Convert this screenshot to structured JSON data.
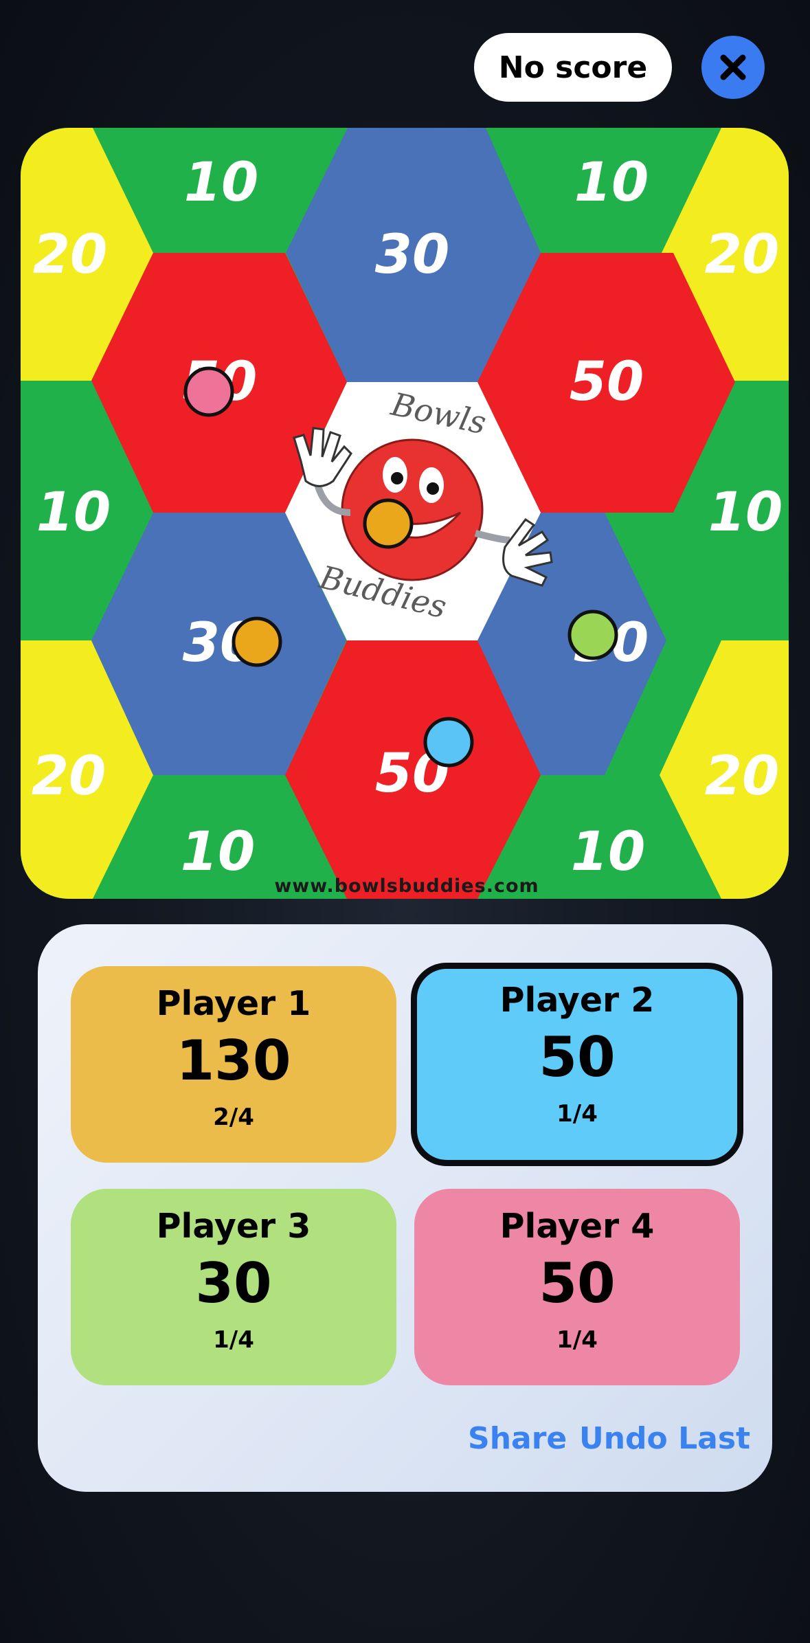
{
  "header": {
    "no_score_label": "No score",
    "close_icon": "close-icon"
  },
  "board": {
    "url": "www.bowlsbuddies.com",
    "logo_word1": "Bowls",
    "logo_word2": "Buddies",
    "zones": {
      "top_left_10": "10",
      "top_right_10": "10",
      "top_left_20": "20",
      "top_right_20": "20",
      "top_30": "30",
      "upper_left_50": "50",
      "upper_right_50": "50",
      "mid_left_10": "10",
      "mid_right_10": "10",
      "lower_left_30": "30",
      "lower_right_30": "30",
      "bottom_left_20": "20",
      "bottom_right_20": "20",
      "bottom_50": "50",
      "bottom_left_10": "10",
      "bottom_right_10": "10"
    },
    "colors": {
      "green": "#21b14b",
      "yellow": "#f3ec1e",
      "blue": "#4a72b8",
      "red": "#ef1f26",
      "white": "#ffffff"
    }
  },
  "players": [
    {
      "name": "Player 1",
      "score": "130",
      "turns": "2/4",
      "color": "#ebbc4a",
      "marker": "#eba71b",
      "active": false
    },
    {
      "name": "Player 2",
      "score": "50",
      "turns": "1/4",
      "color": "#5fcbf9",
      "marker": "#5ac4f6",
      "active": true
    },
    {
      "name": "Player 3",
      "score": "30",
      "turns": "1/4",
      "color": "#b1e07e",
      "marker": "#9ad556",
      "active": false
    },
    {
      "name": "Player 4",
      "score": "50",
      "turns": "1/4",
      "color": "#ee86a6",
      "marker": "#ef7399",
      "active": false
    }
  ],
  "actions": {
    "share_label": "Share",
    "undo_label": "Undo Last"
  }
}
